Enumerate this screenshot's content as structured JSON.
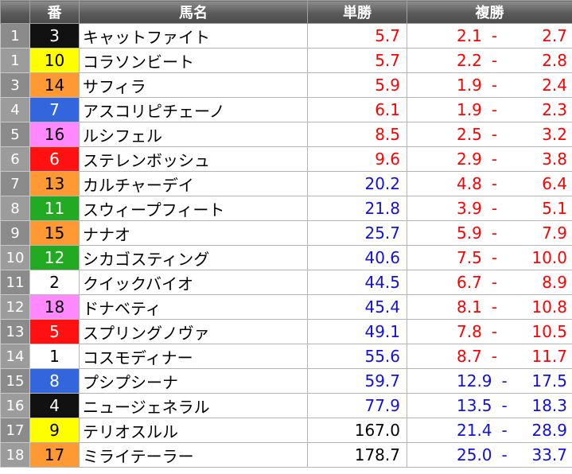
{
  "headers": {
    "rank": "",
    "number": "番",
    "name": "馬名",
    "win": "単勝",
    "place": "複勝"
  },
  "colors": {
    "high_odds_text": "#ff0000",
    "low_odds_text": "#1010e0",
    "default_text": "#000000"
  },
  "rows": [
    {
      "rank": "1",
      "num": "3",
      "bg": "#111111",
      "fg": "#ffffff",
      "name": "キャットファイト",
      "win": "5.7",
      "place_lo": "2.1",
      "place_hi": "2.7",
      "wc": "red",
      "pc": "red"
    },
    {
      "rank": "1",
      "num": "10",
      "bg": "#ffff00",
      "fg": "#000000",
      "name": "コラソンビート",
      "win": "5.7",
      "place_lo": "2.2",
      "place_hi": "2.8",
      "wc": "red",
      "pc": "red"
    },
    {
      "rank": "3",
      "num": "14",
      "bg": "#ff9933",
      "fg": "#000000",
      "name": "サフィラ",
      "win": "5.9",
      "place_lo": "1.9",
      "place_hi": "2.4",
      "wc": "red",
      "pc": "red"
    },
    {
      "rank": "4",
      "num": "7",
      "bg": "#3366dd",
      "fg": "#ffffff",
      "name": "アスコリピチェーノ",
      "win": "6.1",
      "place_lo": "1.9",
      "place_hi": "2.3",
      "wc": "red",
      "pc": "red"
    },
    {
      "rank": "5",
      "num": "16",
      "bg": "#ff88ff",
      "fg": "#000000",
      "name": "ルシフェル",
      "win": "8.5",
      "place_lo": "2.5",
      "place_hi": "3.2",
      "wc": "red",
      "pc": "red"
    },
    {
      "rank": "6",
      "num": "6",
      "bg": "#ff1111",
      "fg": "#ffffff",
      "name": "ステレンボッシュ",
      "win": "9.6",
      "place_lo": "2.9",
      "place_hi": "3.8",
      "wc": "red",
      "pc": "red"
    },
    {
      "rank": "7",
      "num": "13",
      "bg": "#ff9933",
      "fg": "#000000",
      "name": "カルチャーデイ",
      "win": "20.2",
      "place_lo": "4.8",
      "place_hi": "6.4",
      "wc": "blue",
      "pc": "red"
    },
    {
      "rank": "8",
      "num": "11",
      "bg": "#22aa22",
      "fg": "#ffffff",
      "name": "スウィープフィート",
      "win": "21.8",
      "place_lo": "3.9",
      "place_hi": "5.1",
      "wc": "blue",
      "pc": "red"
    },
    {
      "rank": "9",
      "num": "15",
      "bg": "#ff9933",
      "fg": "#000000",
      "name": "ナナオ",
      "win": "25.7",
      "place_lo": "5.9",
      "place_hi": "7.9",
      "wc": "blue",
      "pc": "red"
    },
    {
      "rank": "10",
      "num": "12",
      "bg": "#22aa22",
      "fg": "#ffffff",
      "name": "シカゴスティング",
      "win": "40.6",
      "place_lo": "7.5",
      "place_hi": "10.0",
      "wc": "blue",
      "pc": "red"
    },
    {
      "rank": "11",
      "num": "2",
      "bg": "#ffffff",
      "fg": "#000000",
      "name": "クイックバイオ",
      "win": "44.5",
      "place_lo": "6.7",
      "place_hi": "8.9",
      "wc": "blue",
      "pc": "red"
    },
    {
      "rank": "12",
      "num": "18",
      "bg": "#ff88ff",
      "fg": "#000000",
      "name": "ドナベティ",
      "win": "45.4",
      "place_lo": "8.1",
      "place_hi": "10.8",
      "wc": "blue",
      "pc": "red"
    },
    {
      "rank": "13",
      "num": "5",
      "bg": "#ff1111",
      "fg": "#ffffff",
      "name": "スプリングノヴァ",
      "win": "49.1",
      "place_lo": "7.8",
      "place_hi": "10.5",
      "wc": "blue",
      "pc": "red"
    },
    {
      "rank": "14",
      "num": "1",
      "bg": "#ffffff",
      "fg": "#000000",
      "name": "コスモディナー",
      "win": "55.6",
      "place_lo": "8.7",
      "place_hi": "11.7",
      "wc": "blue",
      "pc": "red"
    },
    {
      "rank": "15",
      "num": "8",
      "bg": "#3366dd",
      "fg": "#ffffff",
      "name": "プシプシーナ",
      "win": "59.7",
      "place_lo": "12.9",
      "place_hi": "17.5",
      "wc": "blue",
      "pc": "blue"
    },
    {
      "rank": "16",
      "num": "4",
      "bg": "#111111",
      "fg": "#ffffff",
      "name": "ニュージェネラル",
      "win": "77.9",
      "place_lo": "13.5",
      "place_hi": "18.3",
      "wc": "blue",
      "pc": "blue"
    },
    {
      "rank": "17",
      "num": "9",
      "bg": "#ffff00",
      "fg": "#000000",
      "name": "テリオスルル",
      "win": "167.0",
      "place_lo": "21.4",
      "place_hi": "28.9",
      "wc": "black",
      "pc": "blue"
    },
    {
      "rank": "18",
      "num": "17",
      "bg": "#ff9933",
      "fg": "#000000",
      "name": "ミライテーラー",
      "win": "178.7",
      "place_lo": "25.0",
      "place_hi": "33.7",
      "wc": "black",
      "pc": "blue"
    }
  ]
}
